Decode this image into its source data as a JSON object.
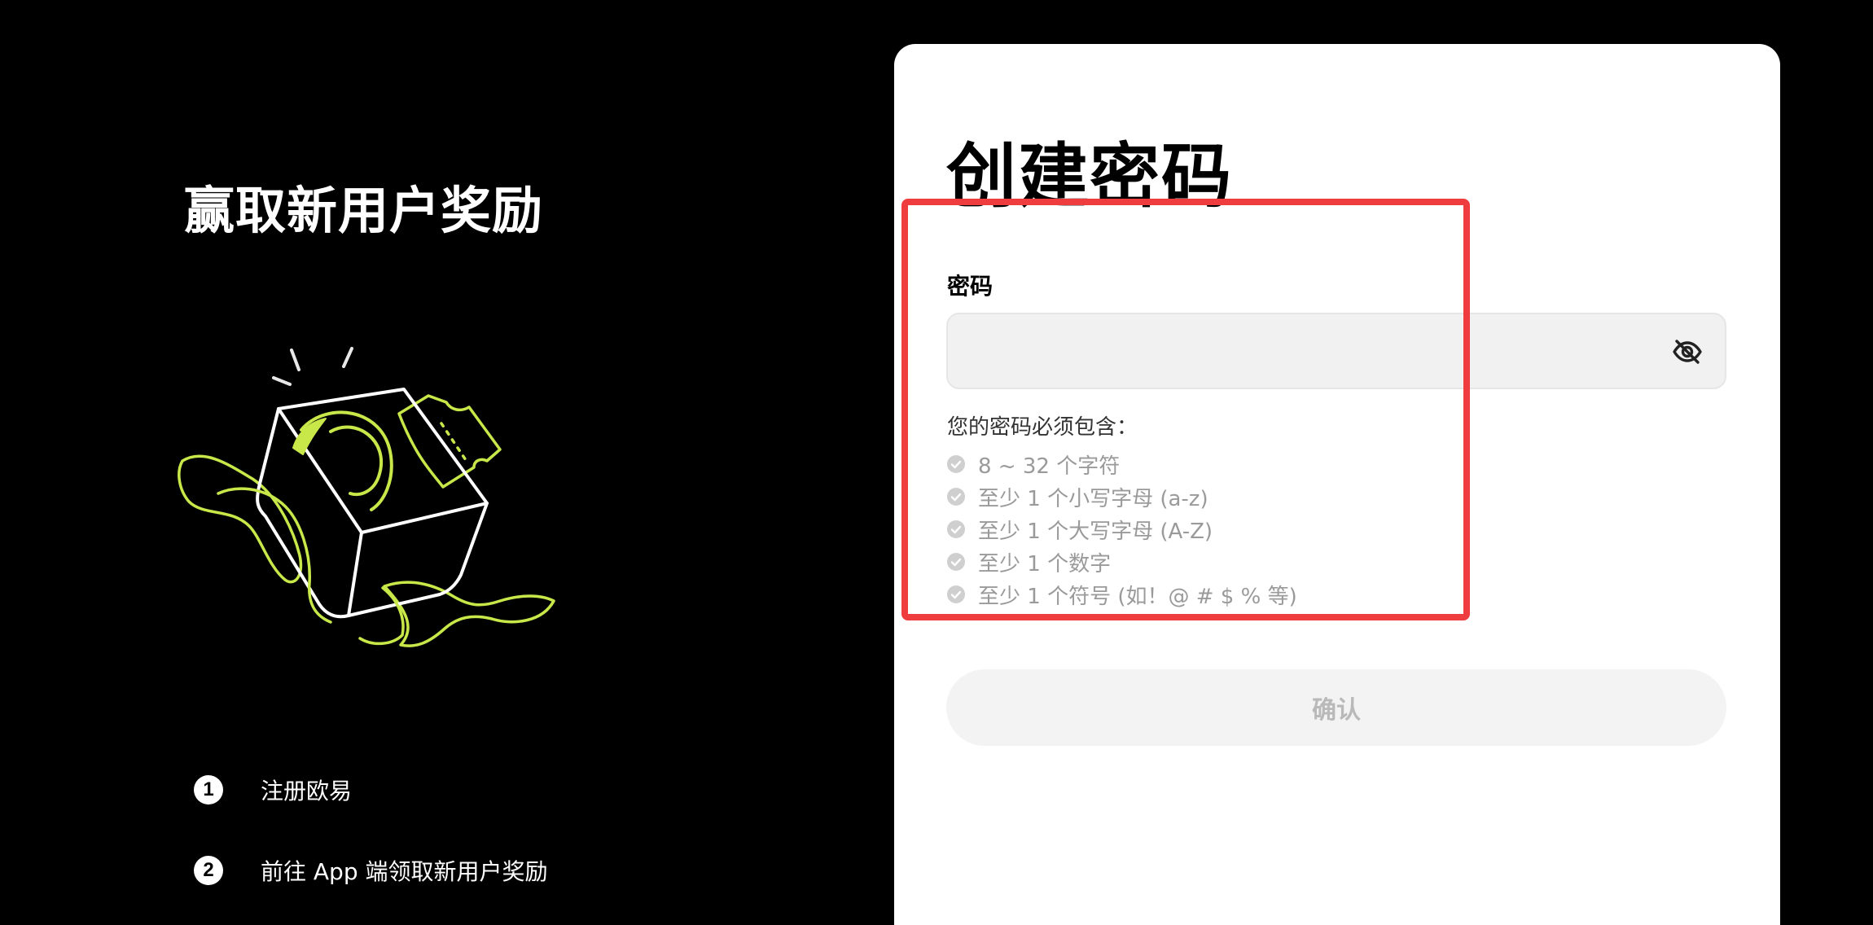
{
  "promo": {
    "title": "赢取新用户奖励",
    "illustration_icon": "gift-box-icon",
    "steps": [
      {
        "number": "1",
        "text": "注册欧易"
      },
      {
        "number": "2",
        "text": "前往 App 端领取新用户奖励"
      }
    ]
  },
  "form": {
    "title": "创建密码",
    "password_label": "密码",
    "password_value": "",
    "visibility_icon": "eye-off-icon",
    "requirements_heading": "您的密码必须包含：",
    "requirements": [
      {
        "text": "8 ~ 32 个字符",
        "met": false
      },
      {
        "text": "至少 1 个小写字母 (a-z)",
        "met": false
      },
      {
        "text": "至少 1 个大写字母 (A-Z)",
        "met": false
      },
      {
        "text": "至少 1 个数字",
        "met": false
      },
      {
        "text": "至少 1 个符号 (如！@ # $ % 等)",
        "met": false
      }
    ],
    "confirm_label": "确认",
    "confirm_enabled": false
  },
  "colors": {
    "background": "#000000",
    "card": "#ffffff",
    "accent_lime": "#c8e84a",
    "highlight": "#ee3c3f",
    "muted_text": "#9a9a9a",
    "disabled_button": "#f3f3f3"
  }
}
